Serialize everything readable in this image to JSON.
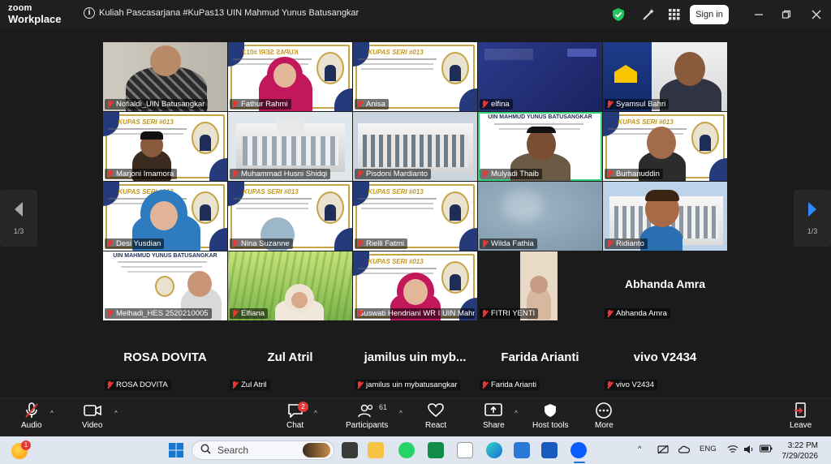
{
  "app": {
    "logo_line1": "zoom",
    "logo_line2": "Workplace",
    "info_glyph": "i",
    "meeting_title": "Kuliah Pascasarjana #KuPas13 UIN Mahmud Yunus Batusangkar",
    "signin_label": "Sign in",
    "icons": [
      "shield-check-icon",
      "magic-wand-icon",
      "apps-grid-icon",
      "minimize-icon",
      "maximize-icon",
      "close-icon"
    ],
    "accent": "#2fd07a",
    "brand_blue": "#0b5cff"
  },
  "participants": [
    {
      "name": "Nofialdi_UIN Batusangkar"
    },
    {
      "name": "Fathur Rahmi"
    },
    {
      "name": "Anisa"
    },
    {
      "name": "elfina"
    },
    {
      "name": "Syamsul Bahri"
    },
    {
      "name": "Marjoni Imamora"
    },
    {
      "name": "Muhammad Husni Shidqi"
    },
    {
      "name": "Pisdoni Mardianto"
    },
    {
      "name": "Mulyadi Thaib"
    },
    {
      "name": "Burhanuddin"
    },
    {
      "name": "Desi Yusdian"
    },
    {
      "name": "Nina Suzanne"
    },
    {
      "name": "Rielli Fatmi"
    },
    {
      "name": "Wilda Fathia"
    },
    {
      "name": "Ridianto"
    },
    {
      "name": "Melhadi_HES 2520210005"
    },
    {
      "name": "Elfiana"
    },
    {
      "name": "Suswati Hendriani WR I UIN Mahmud Yunus Batusangkar"
    },
    {
      "name": "FITRI YENTI"
    },
    {
      "name": "Abhanda Amra"
    }
  ],
  "poster_text": {
    "kupas": "KUPAS SERI #013",
    "uin_header": "UIN MAHMUD YUNUS BATUSANGKAR",
    "mirrored_title": "KUPAS SERI #013"
  },
  "audio_only": [
    {
      "display": "Abhanda Amra"
    }
  ],
  "bottom_row": [
    {
      "display": "ROSA DOVITA",
      "label": "ROSA DOVITA"
    },
    {
      "display": "Zul Atril",
      "label": "Zul Atril"
    },
    {
      "display": "jamilus uin myb...",
      "label": "jamilus uin mybatusangkar"
    },
    {
      "display": "Farida Arianti",
      "label": "Farida Arianti"
    },
    {
      "display": "vivo V2434",
      "label": "vivo V2434"
    }
  ],
  "pager": {
    "left": "1/3",
    "right": "1/3"
  },
  "toolbar": {
    "audio": "Audio",
    "video": "Video",
    "chat": "Chat",
    "chat_badge": "2",
    "participants": "Participants",
    "participants_count": "61",
    "react": "React",
    "share": "Share",
    "host_tools": "Host tools",
    "more": "More",
    "leave": "Leave",
    "caret": "^"
  },
  "taskbar": {
    "search_placeholder": "Search",
    "notify_badge": "1",
    "language": "ENG",
    "time": "3:22 PM",
    "date": "7/29/2026",
    "tray_caret": "^"
  }
}
